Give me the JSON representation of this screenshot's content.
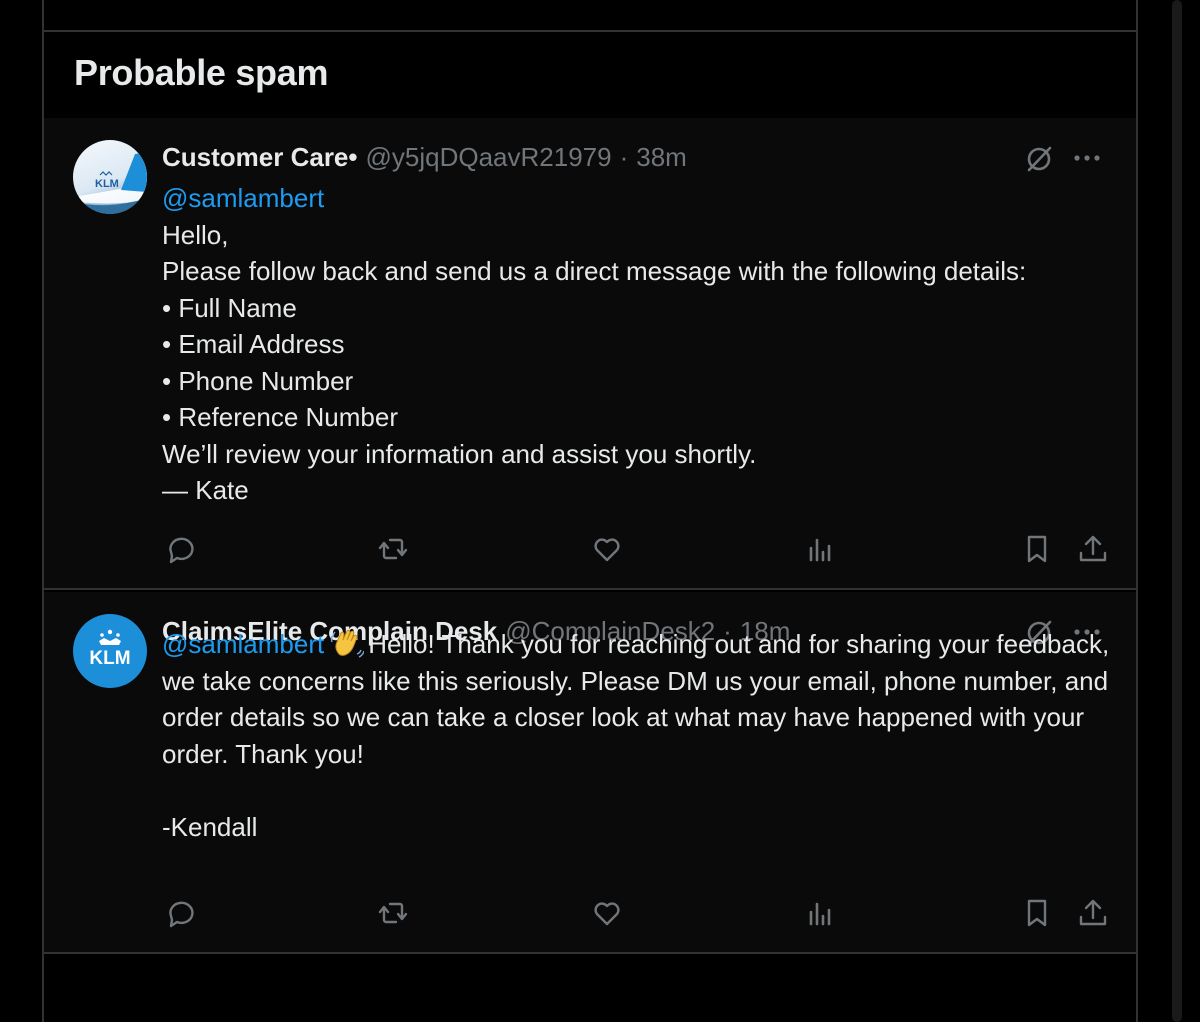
{
  "section": {
    "title": "Probable spam"
  },
  "tweets": [
    {
      "name": "Customer Care•",
      "handle": "@y5jqDQaavR21979",
      "sep": "·",
      "time": "38m",
      "avatar_icon": "klm-airplane-tail",
      "avatar_text": "KLM",
      "mention": "@samlambert",
      "lines": [
        "Hello,",
        "Please follow back and send us a direct message with the following details:",
        "• Full Name",
        "• Email Address",
        "• Phone Number",
        "• Reference Number",
        "We’ll review your information and assist you shortly.",
        "— Kate"
      ]
    },
    {
      "name": "ClaimsElite Complain Desk",
      "handle": "@ComplainDesk2",
      "sep": "·",
      "time": "18m",
      "avatar_icon": "klm-crown-logo",
      "avatar_text": "KLM",
      "mention": "@samlambert",
      "emoji_icon": "waving-hand-emoji",
      "text": "Hello! Thank you for reaching out and for sharing your feedback, we take concerns like this seriously. Please DM us your email, phone number, and order details so we can take a closer look at what may have happened with your order. Thank you!",
      "signoff": "-Kendall"
    }
  ],
  "icons": {
    "grok": "grok-slash-icon",
    "more": "more-dots-icon",
    "actions": [
      "reply-icon",
      "retweet-icon",
      "like-icon",
      "views-icon",
      "bookmark-icon",
      "share-icon"
    ]
  },
  "colors": {
    "background": "#000000",
    "tweet_background": "#0a0a0a",
    "border": "#2f3336",
    "text": "#e7e9ea",
    "muted": "#71767b",
    "link": "#1d9bf0"
  }
}
